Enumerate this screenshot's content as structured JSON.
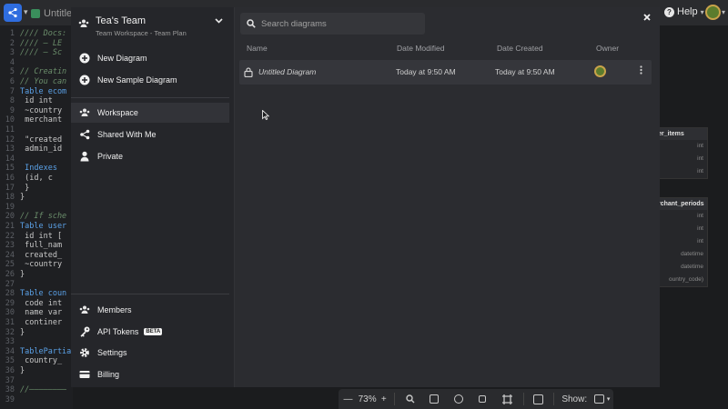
{
  "app": {
    "tab_title": "Untitled",
    "help_label": "Help"
  },
  "editor": {
    "lines": [
      {
        "n": "1",
        "t": "//// Docs:",
        "c": "cm"
      },
      {
        "n": "2",
        "t": "//// — LE",
        "c": "cm"
      },
      {
        "n": "3",
        "t": "//// — Sc",
        "c": "cm"
      },
      {
        "n": "4",
        "t": "",
        "c": ""
      },
      {
        "n": "5",
        "t": "// Creatin",
        "c": "cm"
      },
      {
        "n": "6",
        "t": "// You can",
        "c": "cm"
      },
      {
        "n": "7",
        "t": "Table ecom",
        "c": "kw"
      },
      {
        "n": "8",
        "t": "  id int",
        "c": ""
      },
      {
        "n": "9",
        "t": "  ~country",
        "c": ""
      },
      {
        "n": "10",
        "t": "  merchant",
        "c": ""
      },
      {
        "n": "11",
        "t": "",
        "c": ""
      },
      {
        "n": "12",
        "t": "  \"created",
        "c": ""
      },
      {
        "n": "13",
        "t": "  admin_id",
        "c": ""
      },
      {
        "n": "14",
        "t": "",
        "c": ""
      },
      {
        "n": "15",
        "t": "  Indexes",
        "c": "kw"
      },
      {
        "n": "16",
        "t": "    (id, c",
        "c": ""
      },
      {
        "n": "17",
        "t": "  }",
        "c": ""
      },
      {
        "n": "18",
        "t": "}",
        "c": ""
      },
      {
        "n": "19",
        "t": "",
        "c": ""
      },
      {
        "n": "20",
        "t": "// If sche",
        "c": "cm"
      },
      {
        "n": "21",
        "t": "Table user",
        "c": "kw"
      },
      {
        "n": "22",
        "t": "  id int [",
        "c": ""
      },
      {
        "n": "23",
        "t": "  full_nam",
        "c": ""
      },
      {
        "n": "24",
        "t": "  created_",
        "c": ""
      },
      {
        "n": "25",
        "t": "  ~country",
        "c": ""
      },
      {
        "n": "26",
        "t": "}",
        "c": ""
      },
      {
        "n": "27",
        "t": "",
        "c": ""
      },
      {
        "n": "28",
        "t": "Table coun",
        "c": "kw"
      },
      {
        "n": "29",
        "t": "  code int",
        "c": ""
      },
      {
        "n": "30",
        "t": "  name var",
        "c": ""
      },
      {
        "n": "31",
        "t": "  continer",
        "c": ""
      },
      {
        "n": "32",
        "t": "}",
        "c": ""
      },
      {
        "n": "33",
        "t": "",
        "c": ""
      },
      {
        "n": "34",
        "t": "TablePartia",
        "c": "kw"
      },
      {
        "n": "35",
        "t": "  country_",
        "c": ""
      },
      {
        "n": "36",
        "t": "}",
        "c": ""
      },
      {
        "n": "37",
        "t": "",
        "c": ""
      },
      {
        "n": "38",
        "t": "//————————",
        "c": "cm"
      },
      {
        "n": "39",
        "t": "",
        "c": ""
      }
    ]
  },
  "canvas_tables": [
    {
      "head": "er_items",
      "rows": [
        "int",
        "int",
        "int"
      ]
    },
    {
      "head": "rchant_periods",
      "rows": [
        "int",
        "int",
        "int",
        "datetime",
        "datetime",
        "ountry_code)"
      ]
    }
  ],
  "toolbar": {
    "zoom_minus": "—",
    "zoom_value": "73%",
    "zoom_plus": "+",
    "show_label": "Show:"
  },
  "sidebar": {
    "team_name": "Tea's Team",
    "team_subtitle": "Team Workspace - Team Plan",
    "actions": [
      {
        "label": "New Diagram"
      },
      {
        "label": "New Sample Diagram"
      }
    ],
    "nav": [
      {
        "label": "Workspace"
      },
      {
        "label": "Shared With Me"
      },
      {
        "label": "Private"
      }
    ],
    "bottom": [
      {
        "label": "Members"
      },
      {
        "label": "API Tokens",
        "badge": "BETA"
      },
      {
        "label": "Settings"
      },
      {
        "label": "Billing"
      }
    ]
  },
  "main": {
    "search_placeholder": "Search diagrams",
    "columns": {
      "name": "Name",
      "modified": "Date Modified",
      "created": "Date Created",
      "owner": "Owner"
    },
    "rows": [
      {
        "name": "Untitled Diagram",
        "modified": "Today at 9:50 AM",
        "created": "Today at 9:50 AM"
      }
    ]
  },
  "colors": {
    "modal_bg": "#2b2c30",
    "sidebar_bg": "#25262a",
    "accent_logo": "#2f6ddf"
  }
}
